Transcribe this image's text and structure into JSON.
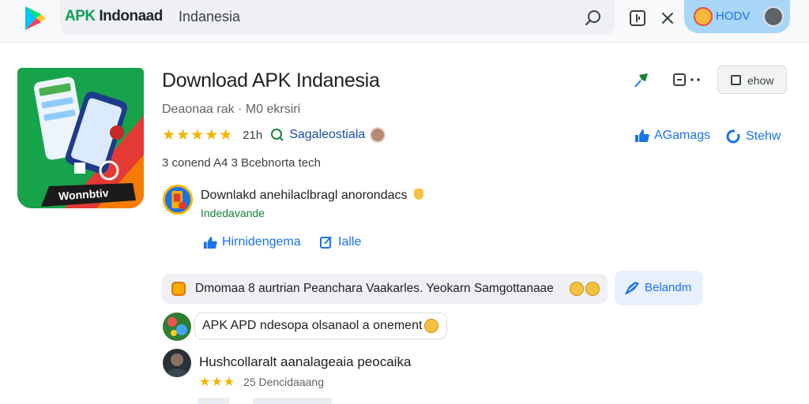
{
  "topbar": {
    "brand_prefix": "APK",
    "brand_rest": " Indonaad",
    "search_query": "Indanesia",
    "account_name": "HODV"
  },
  "app": {
    "icon_caption": "Wonnbtiv",
    "title": "Download APK Indanesia",
    "developer": "Deaonaa rak · M0 ekrsiri",
    "stars": "★★★★★",
    "rating_count": "21h",
    "category": "Sagaleostiala",
    "downloads": "3 conend A4 3 Bcebnorta tech",
    "show_label": "ehow",
    "link_a": "AGamags",
    "link_b": "Stehw"
  },
  "description": {
    "text": "Downlakd anehilaclbragl anorondacs",
    "subtitle": "Indedavande",
    "action_a": "Hirnidengema",
    "action_b": "Ialle"
  },
  "review_banner": {
    "text": "Dmomaa 8 aurtrian Peanchara Vaakarles. Yeokarn Samgottanaae",
    "button_label": "Belandm"
  },
  "comments": [
    {
      "text": "APK APD ndesopa olsanaol a onement"
    },
    {
      "name": "Hushcollaralt aanalageaia peocaika",
      "stars": "★★★",
      "meta": "25 Dencidaaang"
    }
  ],
  "colors": {
    "accent": "#1a73e8",
    "star": "#f4b400",
    "green": "#188038"
  }
}
